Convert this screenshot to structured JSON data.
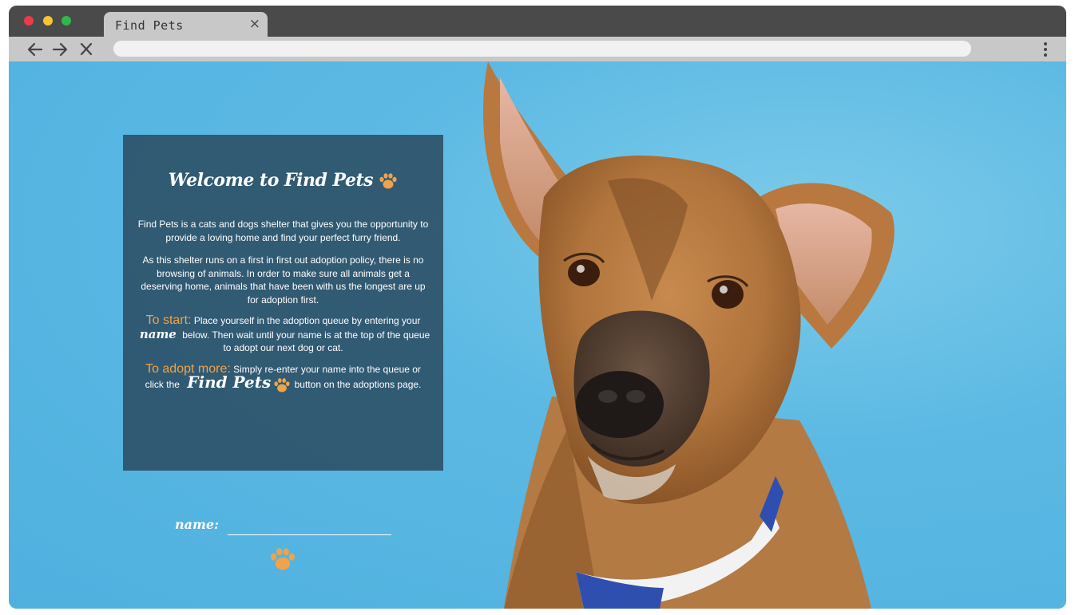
{
  "browser": {
    "tab_title": "Find Pets",
    "tab_close": "×",
    "address_value": ""
  },
  "colors": {
    "accent": "#f0a34a",
    "card_bg": "rgba(40,70,90,0.82)",
    "sky": "#5bb8e2"
  },
  "icons": {
    "back": "arrow-left-icon",
    "forward": "arrow-right-icon",
    "stop": "close-icon",
    "menu": "kebab-menu-icon",
    "paw": "paw-icon"
  },
  "card": {
    "title": "Welcome to Find Pets",
    "intro": "Find Pets is a cats and dogs shelter that gives you the opportunity to provide a loving home and find your perfect furry friend.",
    "policy": "As this shelter runs on a first in first out adoption policy, there is no browsing of animals. In order to make sure all animals get a deserving home, animals that have been with us the longest are up for adoption first.",
    "start_label": "To start:",
    "start_text_a": "Place yourself in the adoption queue by entering your",
    "start_name": "name",
    "start_text_b": "below. Then wait until your name is at the top of the queue to adopt our next dog or cat.",
    "more_label": "To adopt more:",
    "more_text_a": "Simply re-enter your name into the queue or click the",
    "more_brand": "Find Pets",
    "more_text_b": "button on the adoptions page."
  },
  "form": {
    "name_label": "name:",
    "name_value": "",
    "name_placeholder": ""
  }
}
